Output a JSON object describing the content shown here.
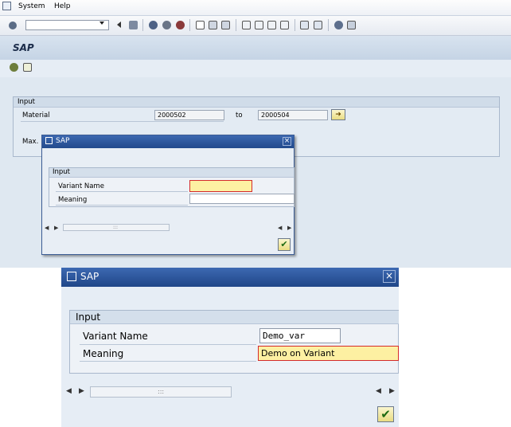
{
  "menubar": {
    "items": [
      "System",
      "Help"
    ]
  },
  "toolbar": {
    "command_value": ""
  },
  "app": {
    "title": "SAP"
  },
  "selection": {
    "group_title": "Input",
    "material_label": "Material",
    "material_from": "2000502",
    "to_label": "to",
    "material_to": "2000504",
    "max_label": "Max. "
  },
  "dialog_small": {
    "title": "SAP",
    "group_title": "Input",
    "variant_label": "Variant Name",
    "variant_value": "",
    "meaning_label": "Meaning",
    "meaning_value": "",
    "scroll_grip": ":::"
  },
  "dialog_large": {
    "title": "SAP",
    "group_title": "Input",
    "variant_label": "Variant Name",
    "variant_value": "Demo_var",
    "meaning_label": "Meaning",
    "meaning_value": "Demo on Variant",
    "scroll_grip": ":::"
  },
  "colors": {
    "title_blue": "#2a5296",
    "highlight_yellow": "#fdf0a2",
    "ok_green": "#1d6a12"
  }
}
